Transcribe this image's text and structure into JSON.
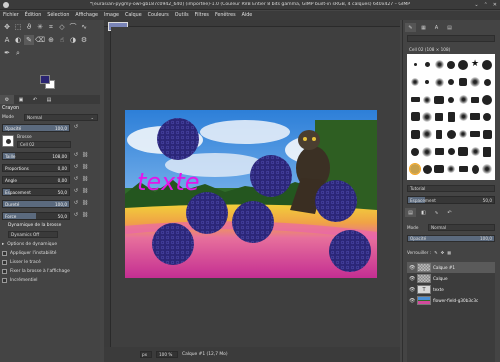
{
  "window": {
    "title": "*[eurasian-pygmy-owl-gb187c0942_640] (importée)-1.0 (Couleur RVB Entier 8 bits gamma, GIMP built-in sRGB, 4 calques) 640x427 – GIMP"
  },
  "menu": [
    "Fichier",
    "Édition",
    "Sélection",
    "Affichage",
    "Image",
    "Calque",
    "Couleurs",
    "Outils",
    "Filtres",
    "Fenêtres",
    "Aide"
  ],
  "tool_options": {
    "heading": "Crayon",
    "mode_label": "Mode",
    "mode_value": "Normal",
    "opacity_label": "Opacité",
    "opacity_value": "100,0",
    "brush_label": "Brosse",
    "brush_value": "Cell 02",
    "size_label": "Taille",
    "size_value": "108,00",
    "aspect_label": "Proportions",
    "aspect_value": "0,00",
    "angle_label": "Angle",
    "angle_value": "0,00",
    "spacing_label": "Espacement",
    "spacing_value": "50,0",
    "hardness_label": "Dureté",
    "hardness_value": "100,0",
    "force_label": "Force",
    "force_value": "50,0",
    "dynamics_label": "Dynamique de la brosse",
    "dynamics_value": "Dynamics Off",
    "checkboxes": [
      "Options de dynamique",
      "Appliquer l'instabilité",
      "Lisser le tracé",
      "Fixer la brosse à l'affichage",
      "Incrémentiel"
    ]
  },
  "canvas": {
    "text_layer": "texte"
  },
  "status": {
    "unit": "px",
    "zoom": "100 %",
    "message": "Calque #1 (12,7 Mo)"
  },
  "brushes": {
    "selected_name": "Cell 02 (108 × 108)",
    "tag_placeholder": "Tutorial",
    "spacing_label": "Espacement",
    "spacing_value": "50,0"
  },
  "layers": {
    "mode_label": "Mode",
    "mode_value": "Normal",
    "opacity_label": "Opacité",
    "opacity_value": "100,0",
    "lock_label": "Verrouiller :",
    "items": [
      {
        "name": "Calque #1"
      },
      {
        "name": "Calque"
      },
      {
        "name": "texte"
      },
      {
        "name": "flower-field-g30b3c3c"
      }
    ]
  },
  "colors": {
    "foreground": "#2a2471",
    "background": "#ffffff",
    "text": "#e316e8"
  }
}
